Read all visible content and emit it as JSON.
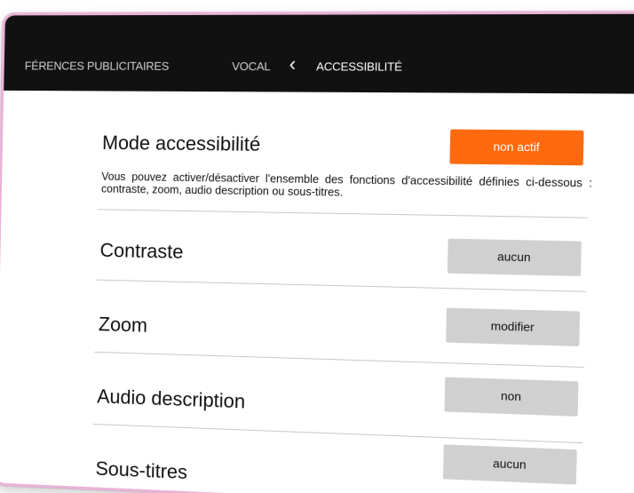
{
  "nav": {
    "prefs_label": "FÉRENCES PUBLICITAIRES",
    "vocal_label": "VOCAL",
    "back_glyph": "‹",
    "current_label": "ACCESSIBILITÉ"
  },
  "accessibility_mode": {
    "title": "Mode accessibilité",
    "button_label": "non actif",
    "description": "Vous pouvez activer/désactiver l'ensemble des fonctions d'accessibilité définies ci-dessous : contraste, zoom, audio description ou sous-titres."
  },
  "rows": [
    {
      "title": "Contraste",
      "button_label": "aucun"
    },
    {
      "title": "Zoom",
      "button_label": "modifier"
    },
    {
      "title": "Audio description",
      "button_label": "non"
    },
    {
      "title": "Sous-titres",
      "button_label": "aucun"
    }
  ],
  "colors": {
    "topbar": "#111111",
    "accent": "#ff6a0f",
    "button_grey": "#d0d0d0",
    "frame": "#e8b4d6"
  }
}
